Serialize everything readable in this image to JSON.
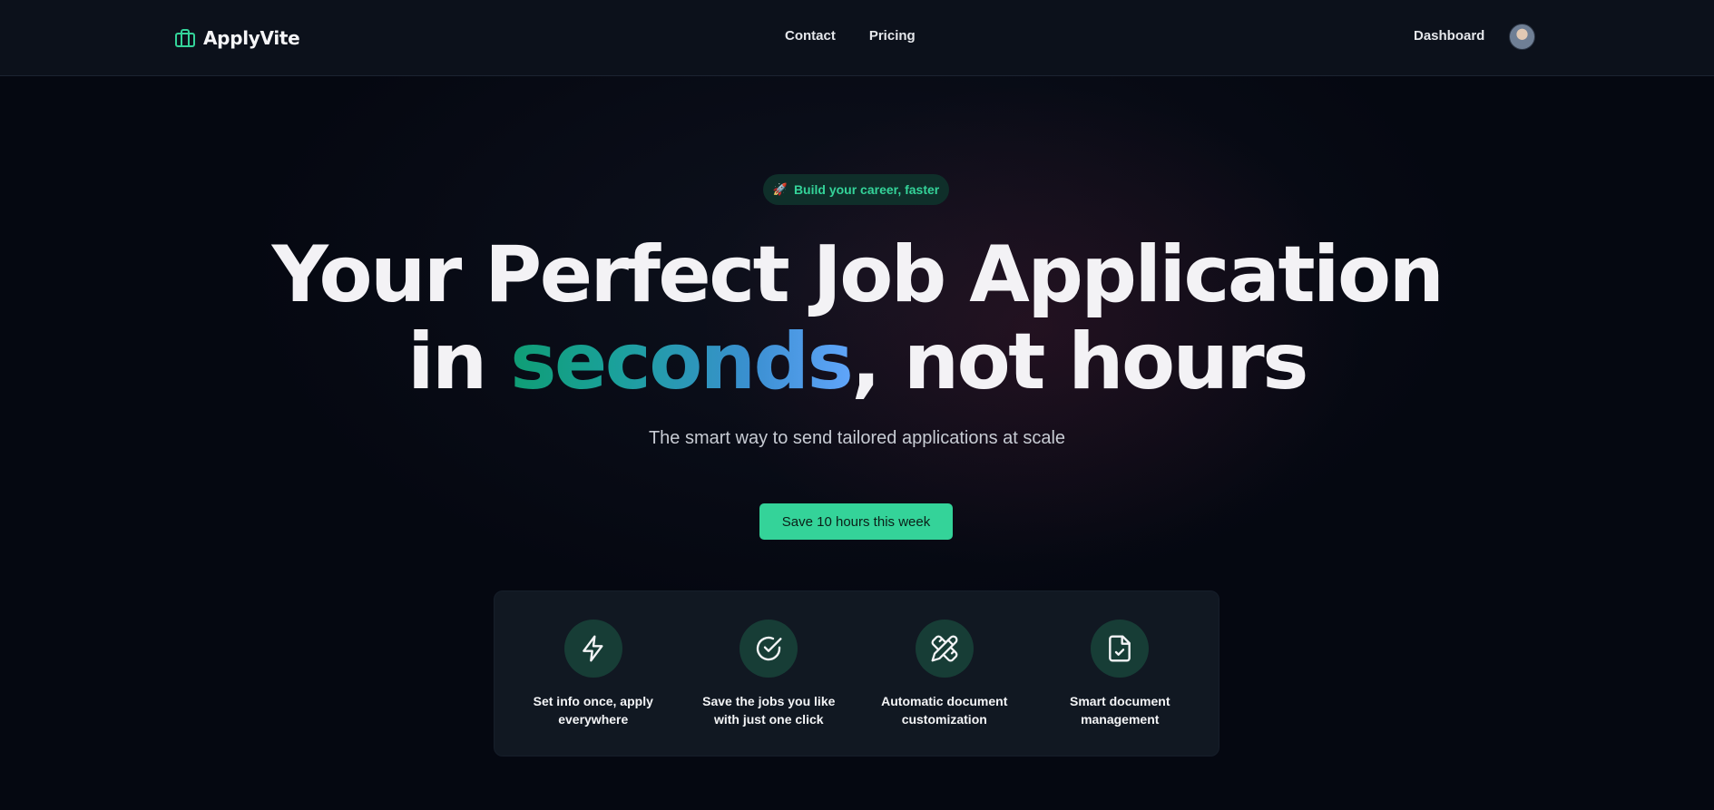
{
  "header": {
    "brand": "ApplyVite",
    "nav": [
      "Contact",
      "Pricing"
    ],
    "dashboard": "Dashboard"
  },
  "hero": {
    "badge_icon": "🚀",
    "badge_text": "Build your career, faster",
    "line1": "Your Perfect Job Application",
    "line2_prefix": "in ",
    "line2_highlight": "seconds",
    "line2_middle": ", not ",
    "line2_struck": "hours",
    "subtitle": "The smart way to send tailored applications at scale",
    "cta": "Save 10 hours this week"
  },
  "features": [
    {
      "icon": "lightning-icon",
      "text": "Set info once, apply everywhere"
    },
    {
      "icon": "check-circle-icon",
      "text": "Save the jobs you like with just one click"
    },
    {
      "icon": "pencil-ruler-icon",
      "text": "Automatic document customization"
    },
    {
      "icon": "file-check-icon",
      "text": "Smart document management"
    }
  ],
  "colors": {
    "accent": "#34d399",
    "background": "#050811",
    "card": "#111822",
    "highlight_bar": "#a3242a",
    "gradient_start": "#0f9d74",
    "gradient_end": "#60a5fa"
  }
}
